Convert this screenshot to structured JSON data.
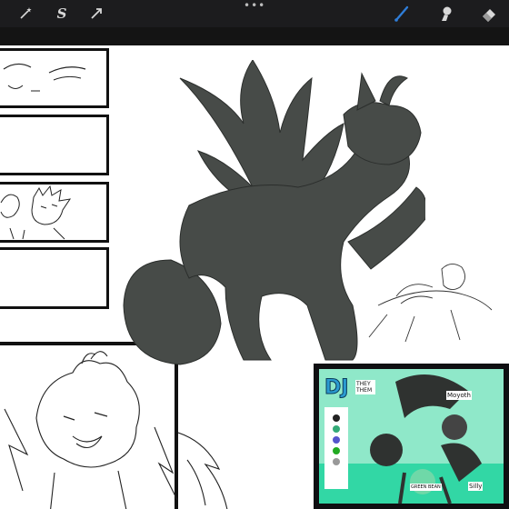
{
  "toolbar": {
    "left_tools": [
      {
        "icon": "magic-wand-icon"
      },
      {
        "icon": "selection-s-icon",
        "glyph": "S"
      },
      {
        "icon": "transform-arrow-icon"
      }
    ],
    "more_glyph": "•••",
    "right_tools": [
      {
        "icon": "brush-icon",
        "active": true
      },
      {
        "icon": "smudge-icon"
      },
      {
        "icon": "eraser-icon"
      }
    ],
    "active_color": "#2f7dd8"
  },
  "colors": {
    "toolbar_bg": "#1c1c1e",
    "canvas_bg": "#ffffff",
    "figure_fill": "#474b48",
    "reference_accent": "#32d7a5"
  },
  "reference": {
    "title": "DJ",
    "pronouns": "THEY THEM",
    "name_note": "Moyoth",
    "side_note": "GREEN BEAN",
    "bottom_note": "Silly"
  }
}
